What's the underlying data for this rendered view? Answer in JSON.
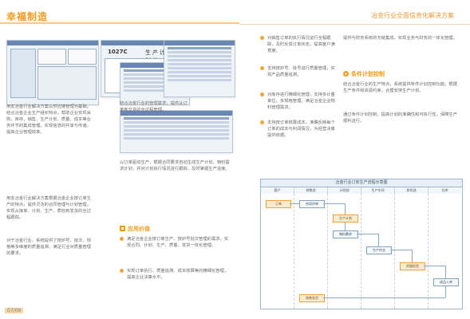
{
  "header": {
    "brand": "幸福制造",
    "tagline": "冶金行业全面信息化解决方案"
  },
  "left_column": {
    "para1": "用友冶金行业解决方案以供应链管理为基础，结合冶金企业生产组织特点，帮助企业实现采购、库存、销售、生产计划、质量、成本等业务环节的集成管理，实现信息的共享与传递，提高企业管理效率。",
    "para2": "用友冶金行业解决方案根据冶金企业按订单生产的特点，提供灵活的合同管理与计划管理，实现从接单、计划、生产、质检到发货的全过程跟踪。",
    "para3": "对于冶金行业，系统提供了按炉号、批次、规格等多维度的质量追溯，满足行业对质量管理的要求。"
  },
  "middle_column": {
    "caption1": "结合冶金行业的管理需求，提供从订单到交货的全过程管理。",
    "para1": "以订单驱动生产，根据合同要求自动生成生产计划、物料需求计划，并对计划执行情况进行跟踪，及时掌握生产进度。",
    "section_title": "应用价值",
    "bullets": [
      "满足冶金企业按订单生产、按炉号批次管理的需求，实现合同、计划、生产、质量、发货一体化管理。",
      "实现订单执行、质量追溯、成本核算等的精细化管理，提高企业决策水平。"
    ]
  },
  "right_column": {
    "bullets": [
      "对销售订单的执行情况进行全程跟踪，及时反馈订单状态，提高客户满意度。",
      "支持按炉号、批号进行质量管理，实现产品质量追溯。",
      "对库存进行精细化管理，支持多计量单位、多规格管理，满足冶金企业物料管理需求。",
      "支持按订单核算成本，准确反映每个订单的成本与利润情况，为经营决策提供依据。"
    ],
    "side_para": "提供与财务系统的无缝集成，实现业务与财务的一体化管理。",
    "section_title": "条件计划控制",
    "section_para1": "结合冶金行业的生产特点，系统提供条件计划控制功能，根据生产条件和资源约束，合理安排生产计划。",
    "section_para2": "通过条件计划控制，提高计划的准确性和可执行性，保障生产顺利进行。"
  },
  "flowchart": {
    "title": "冶金行业订单生产流程示意图",
    "lanes": [
      "客户",
      "销售部",
      "计划部",
      "生产车间",
      "质检部",
      "仓库"
    ],
    "nodes": [
      "订单",
      "合同评审",
      "生产计划",
      "物料需求",
      "生产作业",
      "质量检验",
      "成品入库",
      "销售发货"
    ]
  },
  "mini_screens": {
    "s1_label": "1027C",
    "s1_title": "生产计划单"
  },
  "page_number": "07/08",
  "colors": {
    "accent": "#f39a1a",
    "bullet": "#f2a531",
    "flow_border": "#9bb5d2"
  }
}
